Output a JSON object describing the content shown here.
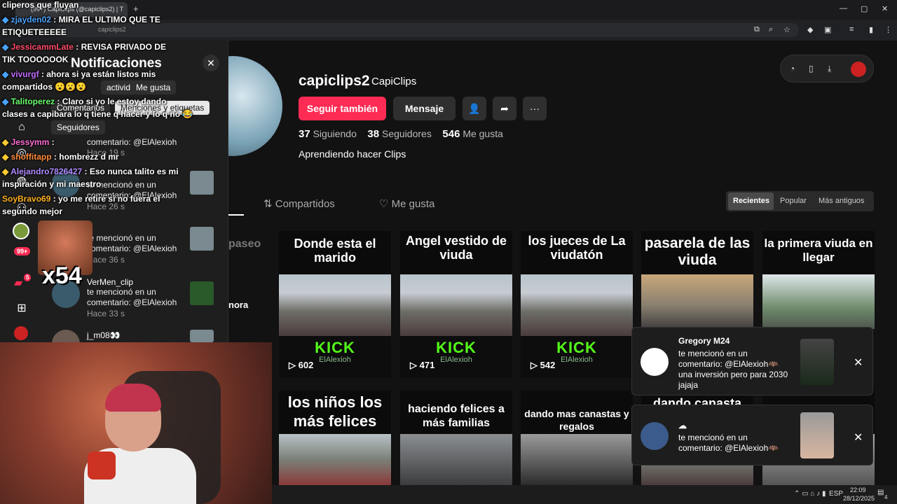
{
  "browser": {
    "tab_title": "(99+) CapiClips (@capiclips2) | T",
    "url": "capiclips2",
    "new_tab": "+",
    "win_min": "—",
    "win_max": "▢",
    "win_close": "✕"
  },
  "notifications": {
    "title": "Notificaciones",
    "close": "✕",
    "filters": [
      "actividad",
      "Me gusta",
      "Comentarios",
      "Menciones y etiquetas",
      "Seguidores"
    ],
    "items": [
      {
        "text1": "comentario: @ElAlexioh",
        "time": "Hace 19 s"
      },
      {
        "text1": "te mencionó en un",
        "text2": "comentario: @ElAlexioh",
        "time": "Hace 26 s"
      },
      {
        "text1": "te mencionó en un",
        "text2": "comentario: @ElAlexioh",
        "time": "Hace 36 s"
      },
      {
        "name": "VerMen_clip",
        "text1": "te mencionó en un",
        "text2": "comentario: @ElAlexioh",
        "time": "Hace 33 s"
      },
      {
        "name": "j_m08👀"
      }
    ]
  },
  "sidebar": {
    "badge_99": "99+",
    "badge_5": "5"
  },
  "profile": {
    "username": "capiclips2",
    "nickname": "CapiClips",
    "follow_label": "Seguir también",
    "message_label": "Mensaje",
    "following_count": "37",
    "following_label": "Siguiendo",
    "followers_count": "38",
    "followers_label": "Seguidores",
    "likes_count": "546",
    "likes_label": "Me gusta",
    "bio": "Aprendiendo hacer Clips"
  },
  "tabs": {
    "videos_partial": "",
    "reposts": "Compartidos",
    "liked": "Me gusta"
  },
  "sort": {
    "recent": "Recientes",
    "popular": "Popular",
    "oldest": "Más antiguos"
  },
  "videos": [
    {
      "caption": "Donde esta el marido",
      "views": "602",
      "kick": "KICK",
      "channel": "ElAlexioh"
    },
    {
      "caption": "Angel vestido de viuda",
      "views": "471",
      "kick": "KICK",
      "channel": "ElAlexioh"
    },
    {
      "caption": "los jueces de La viudatón",
      "views": "542",
      "kick": "KICK",
      "channel": "ElAlexioh"
    },
    {
      "caption": "pasarela de las viuda"
    },
    {
      "caption": "la primera viuda en llegar"
    },
    {
      "caption": "los niños los más felices"
    },
    {
      "caption": "haciendo felices a más familias"
    },
    {
      "caption": "dando mas canastas y regalos"
    },
    {
      "caption": "dando canasta"
    }
  ],
  "partial_left_text": {
    "paseo": "paseo",
    "nora": "nora"
  },
  "popups": [
    {
      "name": "Gregory M24",
      "line1": "te mencionó en un",
      "line2": "comentario: @ElAlexioh🦇",
      "line3": "una inversión pero para 2030",
      "line4": "jajaja",
      "close": "✕"
    },
    {
      "name": "☁",
      "line1": "te mencionó en un",
      "line2": "comentario: @ElAlexioh🦇",
      "close": "✕"
    }
  ],
  "chat": [
    {
      "user": "",
      "msg": "cliperos que fluyan"
    },
    {
      "user": "zjayden02",
      "msg": ": MIRA EL ULTIMO QUE TE"
    },
    {
      "user": "",
      "msg": "ETIQUETEEEEE"
    },
    {
      "user": "JessicammLate",
      "msg": ": REVISA PRIVADO DE"
    },
    {
      "user": "",
      "msg": "TIK TOOOOOOK"
    },
    {
      "user": "vivurgf",
      "msg": ": ahora si ya están listos mis"
    },
    {
      "user": "",
      "msg": "compartidos 😮😮😮"
    },
    {
      "user": "Talitoperez",
      "msg": ": Claro si yo le estoy dando"
    },
    {
      "user": "",
      "msg": "clases a capibara lo q tiene q hacer y lo q no 😂"
    },
    {
      "user": "Jessymm",
      "msg": ":"
    },
    {
      "user": "shoffitapp",
      "msg": ": hombrezz d mr"
    },
    {
      "user": "Alejandro7826427",
      "msg": ": Eso nunca talito es mi"
    },
    {
      "user": "",
      "msg": "inspiración y mi maestro"
    },
    {
      "user": "SoyBravo69",
      "msg": ": yo me retire si no fuera el"
    },
    {
      "user": "",
      "msg": "segundo mejor"
    }
  ],
  "emote_label": "x54",
  "taskbar": {
    "lang": "ESP",
    "time": "22:09",
    "date": "28/12/2025",
    "notif_count": "4"
  }
}
